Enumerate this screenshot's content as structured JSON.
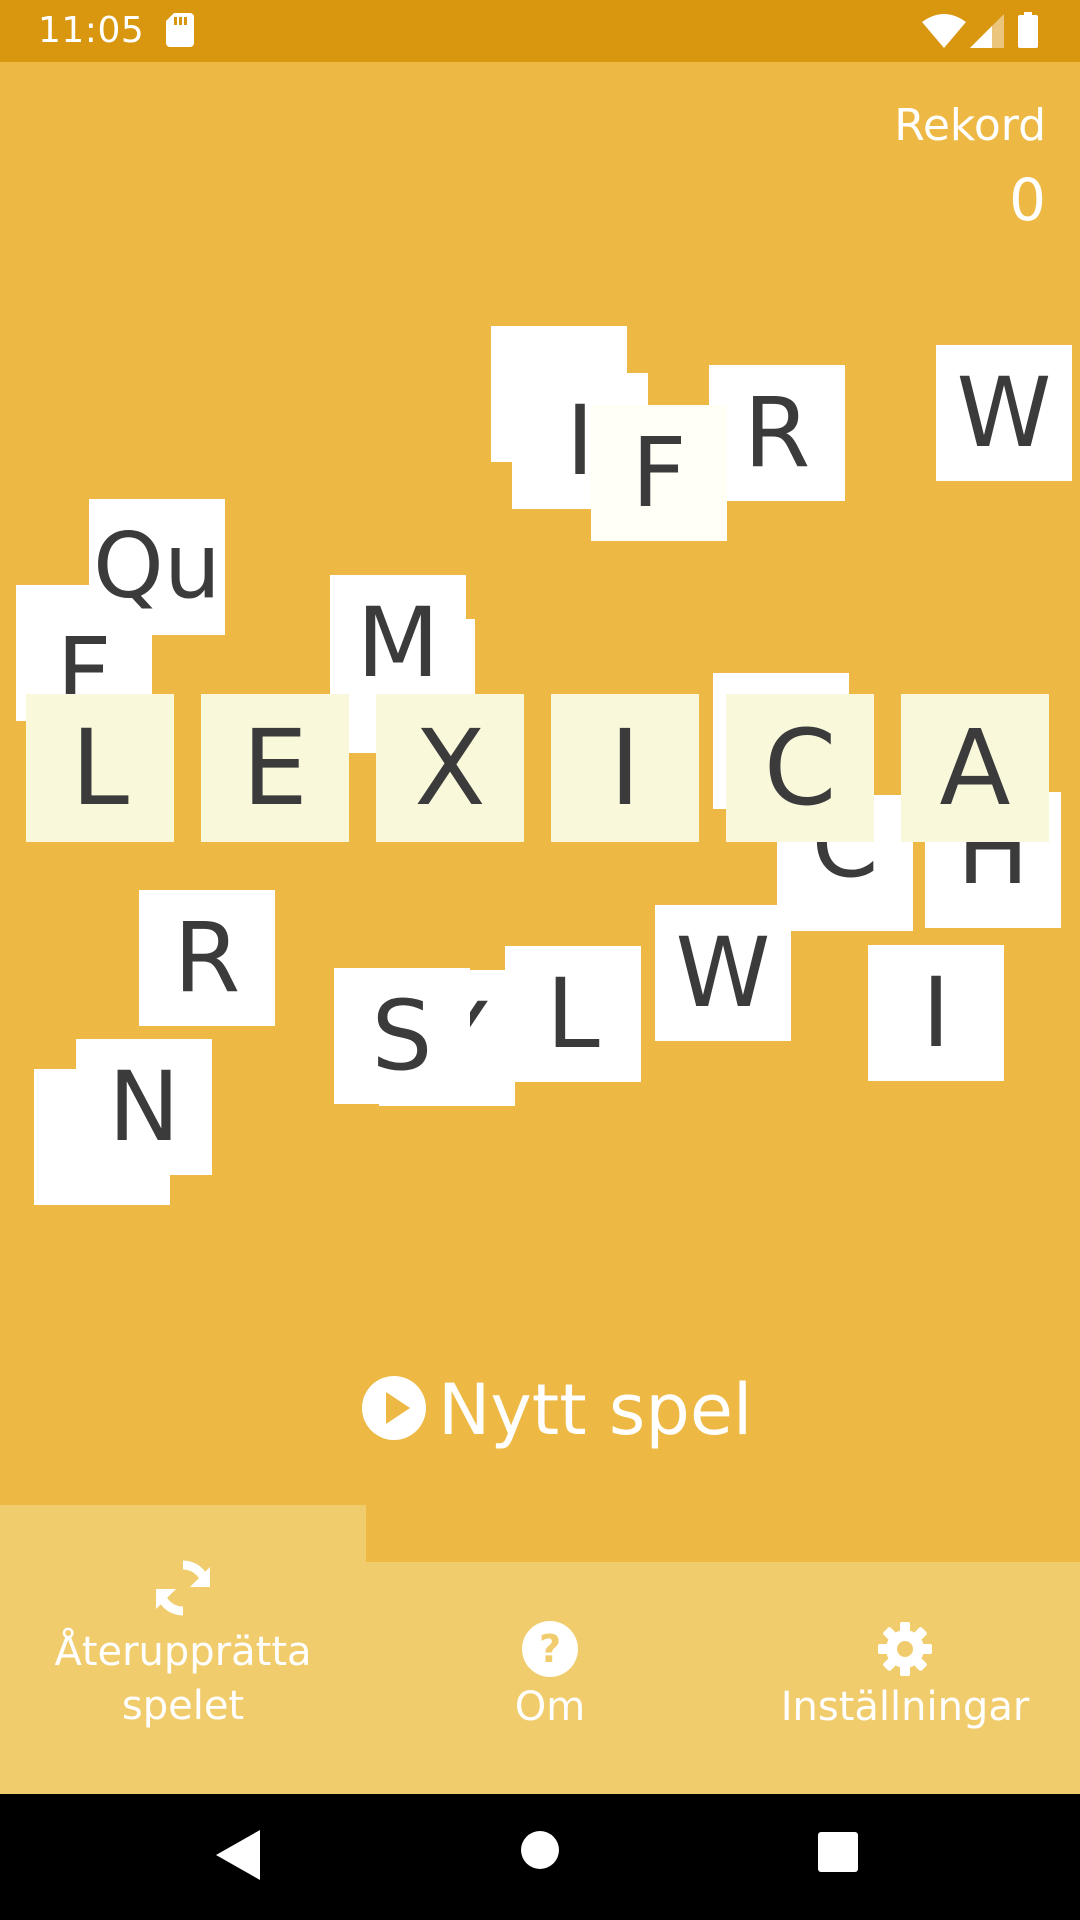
{
  "status_bar": {
    "time": "11:05",
    "icons": [
      "sd-card-icon",
      "wifi-icon",
      "signal-icon",
      "battery-icon"
    ]
  },
  "record": {
    "label": "Rekord",
    "value": "0"
  },
  "tiles": {
    "s": "S",
    "i_top": "I",
    "f_top": "F",
    "r_top": "R",
    "w_top": "W",
    "qu": "Qu",
    "f_left": "F",
    "m": "M",
    "c_low": "C",
    "h_low": "H",
    "r_mid": "R",
    "s_mid": "S",
    "y_mid": "Y",
    "l_mid": "L",
    "w_mid": "W",
    "i_mid": "I",
    "n": "N"
  },
  "title_tiles": [
    "L",
    "E",
    "X",
    "I",
    "C",
    "A"
  ],
  "new_game": {
    "label": "Nytt spel",
    "icon": "play-circle-icon"
  },
  "bottom_nav": {
    "restore": {
      "label": "Återupprätta\nspelet",
      "icon": "refresh-icon"
    },
    "about": {
      "label": "Om",
      "icon": "help-circle-icon"
    },
    "settings": {
      "label": "Inställningar",
      "icon": "gear-icon"
    }
  },
  "system_nav": [
    "back-icon",
    "home-icon",
    "recent-apps-icon"
  ],
  "colors": {
    "background": "#EDB843",
    "status_bar": "#D9960F",
    "bottom_nav": "#F0CC6D",
    "tile": "#FFFFFF",
    "title_tile": "#F9F8DA",
    "letter": "#3B3B3B"
  }
}
